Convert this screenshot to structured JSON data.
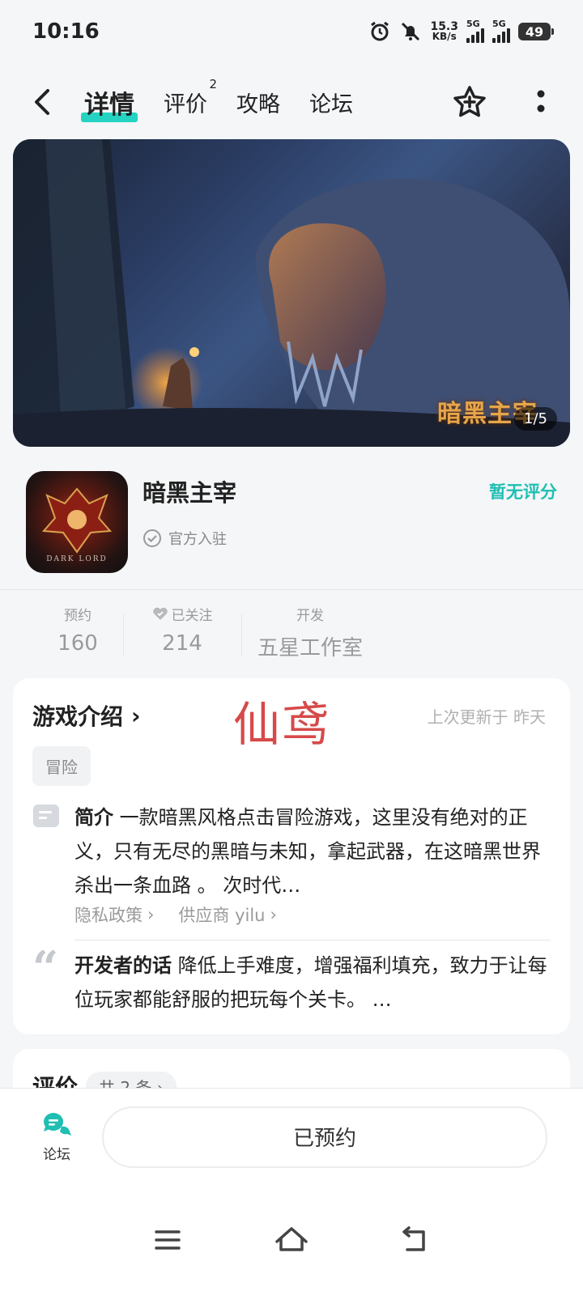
{
  "status": {
    "time": "10:16",
    "net_speed_value": "15.3",
    "net_speed_unit": "KB/s",
    "network1": "5G",
    "network2": "5G",
    "battery": "49"
  },
  "nav": {
    "tabs": [
      {
        "label": "详情",
        "active": true
      },
      {
        "label": "评价",
        "badge": "2"
      },
      {
        "label": "攻略"
      },
      {
        "label": "论坛"
      }
    ]
  },
  "banner": {
    "logo_text": "暗黑主宰",
    "counter": "1/5"
  },
  "game": {
    "title": "暗黑主宰",
    "icon_caption": "DARK LORD",
    "official_label": "官方入驻",
    "rating_text": "暂无评分"
  },
  "stats": [
    {
      "label": "预约",
      "value": "160"
    },
    {
      "label": "已关注",
      "value": "214"
    },
    {
      "label": "开发",
      "value": "五星工作室"
    }
  ],
  "intro": {
    "title": "游戏介绍",
    "watermark": "仙鸢",
    "updated": "上次更新于 昨天",
    "tag": "冒险",
    "summary_label": "简介",
    "summary_text": "一款暗黑风格点击冒险游戏，这里没有绝对的正义，只有无尽的黑暗与未知，拿起武器，在这暗黑世界杀出一条血路 。 次时代…",
    "privacy_link": "隐私政策",
    "supplier_link": "供应商 yilu",
    "dev_label": "开发者的话",
    "dev_text": "降低上手难度，增强福利填充，致力于让每位玩家都能舒服的把玩每个关卡。 …"
  },
  "reviews": {
    "title": "评价",
    "count": "共 2 条"
  },
  "bottom": {
    "forum_label": "论坛",
    "reserve_label": "已预约"
  },
  "colors": {
    "accent": "#24d3c2",
    "rating": "#1fbfb2",
    "watermark": "#d64a4a"
  }
}
